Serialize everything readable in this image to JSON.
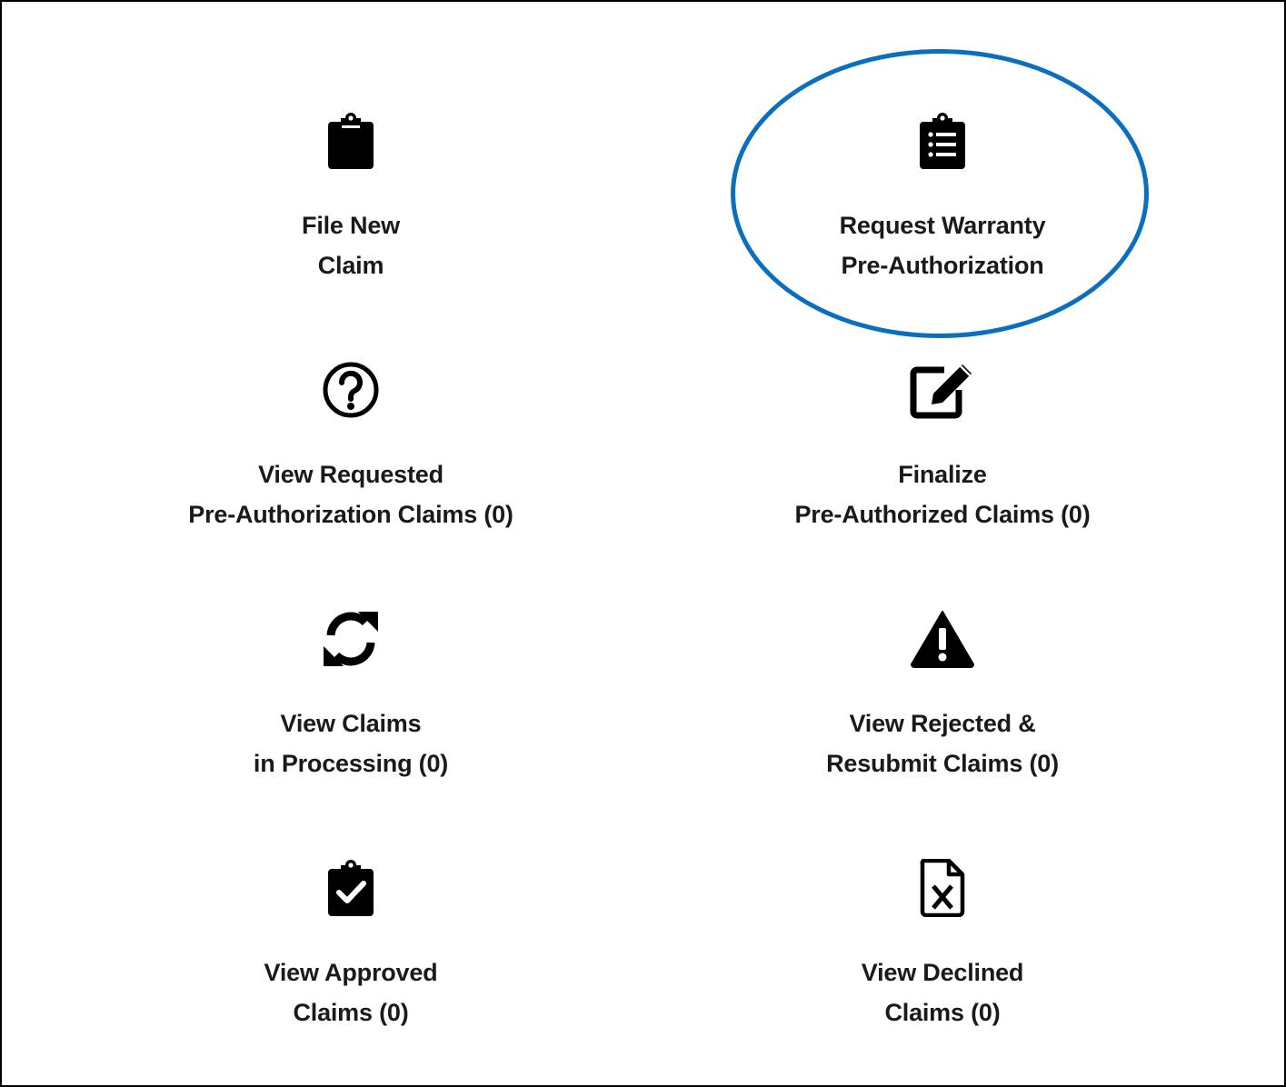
{
  "highlight_color": "#0a6fbf",
  "tiles": [
    {
      "icon": "clipboard-icon",
      "line1": "File New",
      "line2": "Claim"
    },
    {
      "icon": "clipboard-list-icon",
      "line1": "Request Warranty",
      "line2": "Pre-Authorization"
    },
    {
      "icon": "question-circle-icon",
      "line1": "View Requested",
      "line2": "Pre-Authorization Claims (0)"
    },
    {
      "icon": "edit-icon",
      "line1": "Finalize",
      "line2": "Pre-Authorized Claims (0)"
    },
    {
      "icon": "sync-icon",
      "line1": "View Claims",
      "line2": "in Processing (0)"
    },
    {
      "icon": "warning-icon",
      "line1": "View Rejected &",
      "line2": "Resubmit Claims (0)"
    },
    {
      "icon": "clipboard-check-icon",
      "line1": "View Approved",
      "line2": "Claims (0)"
    },
    {
      "icon": "file-excel-icon",
      "line1": "View Declined",
      "line2": "Claims (0)"
    }
  ]
}
